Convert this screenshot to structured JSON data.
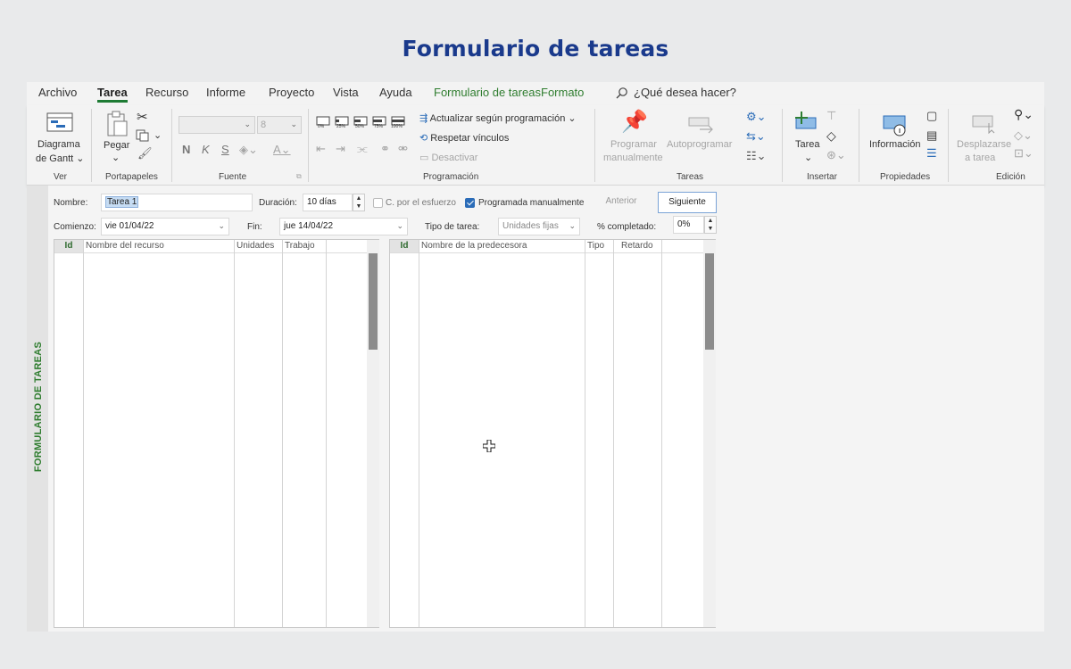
{
  "heading": "Formulario de tareas",
  "menu": {
    "tabs": [
      "Archivo",
      "Tarea",
      "Recurso",
      "Informe",
      "Proyecto",
      "Vista",
      "Ayuda",
      "Formulario de tareas",
      "Formato"
    ],
    "search_label": "¿Qué desea hacer?"
  },
  "ribbon": {
    "groups": {
      "ver": "Ver",
      "portapapeles": "Portapapeles",
      "fuente": "Fuente",
      "programacion": "Programación",
      "tareas": "Tareas",
      "insertar": "Insertar",
      "propiedades": "Propiedades",
      "edicion": "Edición"
    },
    "gantt_line1": "Diagrama",
    "gantt_line2": "de Gantt",
    "paste": "Pegar",
    "font_size": "8",
    "bold": "N",
    "italic": "K",
    "underline": "S",
    "percent_labels": [
      "0%",
      "25%",
      "50%",
      "75%",
      "100%"
    ],
    "update_schedule": "Actualizar según programación",
    "respect_links": "Respetar vínculos",
    "deactivate": "Desactivar",
    "schedule_manual_1": "Programar",
    "schedule_manual_2": "manualmente",
    "auto_schedule": "Autoprogramar",
    "task": "Tarea",
    "information": "Información",
    "scroll_to_task_1": "Desplazarse",
    "scroll_to_task_2": "a tarea"
  },
  "sidebar_label": "FORMULARIO DE TAREAS",
  "form": {
    "name_label": "Nombre:",
    "name_value": "Tarea 1",
    "duration_label": "Duración:",
    "duration_value": "10 días",
    "effort_label": "C. por el esfuerzo",
    "effort_checked": false,
    "manual_label": "Programada manualmente",
    "manual_checked": true,
    "previous": "Anterior",
    "next": "Siguiente",
    "start_label": "Comienzo:",
    "start_value": "vie 01/04/22",
    "finish_label": "Fin:",
    "finish_value": "jue 14/04/22",
    "task_type_label": "Tipo de tarea:",
    "task_type_value": "Unidades fijas",
    "pct_label": "% completado:",
    "pct_value": "0%"
  },
  "resource_table": {
    "columns": [
      "Id",
      "Nombre del recurso",
      "Unidades",
      "Trabajo"
    ],
    "rows": []
  },
  "predecessor_table": {
    "columns": [
      "Id",
      "Nombre de la predecesora",
      "Tipo",
      "Retardo"
    ],
    "rows": []
  },
  "colors": {
    "heading": "#1a3a8c",
    "accent_green": "#1e7b34",
    "checkbox_blue": "#2b6cb8"
  }
}
